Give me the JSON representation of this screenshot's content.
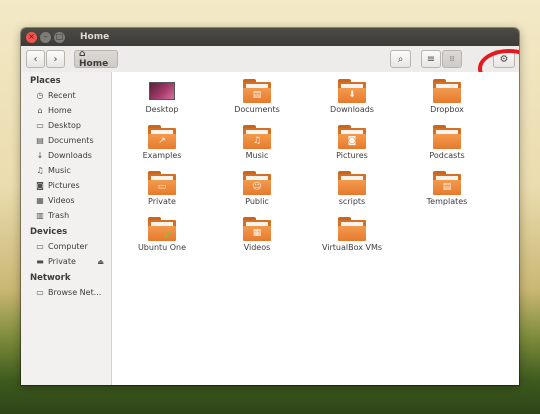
{
  "window": {
    "title": "Home"
  },
  "titlebar_buttons": {
    "close": "×",
    "minimize": "–",
    "maximize": "□"
  },
  "toolbar": {
    "back_glyph": "‹",
    "forward_glyph": "›",
    "crumb_icon": "⌂",
    "crumb_label": "Home",
    "search_glyph": "⌕",
    "list_view_glyph": "≡",
    "grid_view_glyph": "⁞⁞",
    "settings_glyph": "⚙"
  },
  "sidebar": {
    "sections": [
      {
        "title": "Places",
        "items": [
          {
            "label": "Recent",
            "icon": "clock-icon",
            "glyph": "◷"
          },
          {
            "label": "Home",
            "icon": "home-icon",
            "glyph": "⌂"
          },
          {
            "label": "Desktop",
            "icon": "desktop-icon",
            "glyph": "▭"
          },
          {
            "label": "Documents",
            "icon": "document-icon",
            "glyph": "▤"
          },
          {
            "label": "Downloads",
            "icon": "download-icon",
            "glyph": "↓"
          },
          {
            "label": "Music",
            "icon": "music-icon",
            "glyph": "♫"
          },
          {
            "label": "Pictures",
            "icon": "camera-icon",
            "glyph": "◙"
          },
          {
            "label": "Videos",
            "icon": "film-icon",
            "glyph": "▦"
          },
          {
            "label": "Trash",
            "icon": "trash-icon",
            "glyph": "▥"
          }
        ]
      },
      {
        "title": "Devices",
        "items": [
          {
            "label": "Computer",
            "icon": "computer-icon",
            "glyph": "▭"
          },
          {
            "label": "Private",
            "icon": "drive-icon",
            "glyph": "▬",
            "eject": "⏏"
          }
        ]
      },
      {
        "title": "Network",
        "items": [
          {
            "label": "Browse Net...",
            "icon": "network-icon",
            "glyph": "▭"
          }
        ]
      }
    ]
  },
  "files": [
    {
      "label": "Desktop",
      "icon": "desktop-folder-icon",
      "type": "desktop",
      "emblem": ""
    },
    {
      "label": "Documents",
      "icon": "documents-folder-icon",
      "type": "folder",
      "emblem": "▤"
    },
    {
      "label": "Downloads",
      "icon": "downloads-folder-icon",
      "type": "folder",
      "emblem": "⬇"
    },
    {
      "label": "Dropbox",
      "icon": "dropbox-folder-icon",
      "type": "folder",
      "emblem": ""
    },
    {
      "label": "Examples",
      "icon": "examples-folder-icon",
      "type": "folder",
      "emblem": "↗"
    },
    {
      "label": "Music",
      "icon": "music-folder-icon",
      "type": "folder",
      "emblem": "♫"
    },
    {
      "label": "Pictures",
      "icon": "pictures-folder-icon",
      "type": "folder",
      "emblem": "◙"
    },
    {
      "label": "Podcasts",
      "icon": "podcasts-folder-icon",
      "type": "folder",
      "emblem": ""
    },
    {
      "label": "Private",
      "icon": "private-folder-icon",
      "type": "folder",
      "emblem": "▭"
    },
    {
      "label": "Public",
      "icon": "public-folder-icon",
      "type": "folder",
      "emblem": "☺"
    },
    {
      "label": "scripts",
      "icon": "scripts-folder-icon",
      "type": "folder",
      "emblem": ""
    },
    {
      "label": "Templates",
      "icon": "templates-folder-icon",
      "type": "folder",
      "emblem": "▤"
    },
    {
      "label": "Ubuntu One",
      "icon": "ubuntu-one-folder-icon",
      "type": "folder",
      "emblem": "",
      "check": "✔"
    },
    {
      "label": "Videos",
      "icon": "videos-folder-icon",
      "type": "folder",
      "emblem": "▦"
    },
    {
      "label": "VirtualBox VMs",
      "icon": "virtualbox-folder-icon",
      "type": "folder",
      "emblem": ""
    }
  ],
  "colors": {
    "folder_orange": "#e67a2e",
    "annotation_red": "#e8181f",
    "titlebar": "#3c3b37"
  }
}
